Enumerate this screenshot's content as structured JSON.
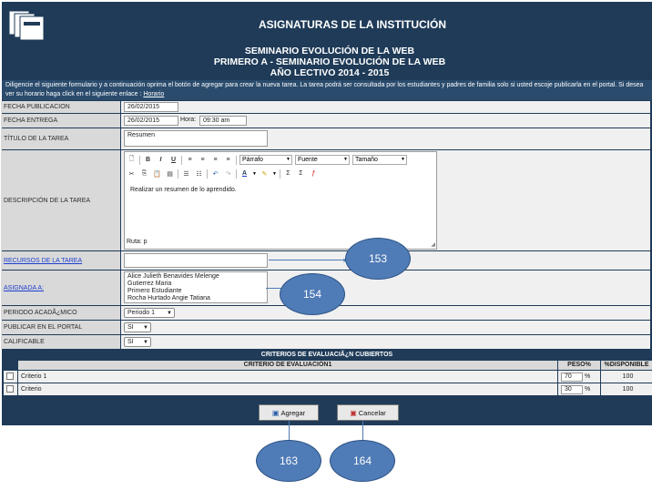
{
  "header": {
    "title": "ASIGNATURAS DE LA INSTITUCIÓN",
    "line1": "SEMINARIO EVOLUCIÓN DE LA WEB",
    "line2": "PRIMERO A - SEMINARIO EVOLUCIÓN DE LA WEB",
    "line3": "AÑO LECTIVO 2014 - 2015"
  },
  "notice": {
    "text": "Diligencie el siguiente formulario y a continuación oprima el botón de agregar para crear la nueva tarea. La tarea podrá ser consultada por los estudiantes y padres de familia solo si usted escoje publicarla en el portal. Si desea ver su horario haga click en el siguiente enlace :",
    "link": "Horario"
  },
  "form": {
    "fecha_publicacion_label": "FECHA PUBLICACION",
    "fecha_publicacion_value": "26/02/2015",
    "fecha_entrega_label": "FECHA ENTREGA",
    "fecha_entrega_value": "26/02/2015",
    "hora_label": "Hora:",
    "hora_value": "09:30 am",
    "titulo_label": "TÍTULO DE LA TAREA",
    "titulo_value": "Resumen",
    "descripcion_label": "DESCRIPCIÓN DE LA TAREA",
    "descripcion_value": "Realizar un resumen de lo aprendido.",
    "editor_path": "Ruta: p",
    "editor_format": "Párrafo",
    "editor_font": "Fuente",
    "editor_size": "Tamaño",
    "recursos_label": "RECURSOS DE LA TAREA",
    "asignada_label": "ASIGNADA A:",
    "students": [
      "Alice Julieth Benavides Melenge",
      "Gutierrez Maria",
      "Primero Estudiante",
      "Rocha Hurtado Angie Tatiana"
    ],
    "periodo_label": "PERIODO ACADÃ¿MICO",
    "periodo_value": "Periodo 1",
    "publicar_label": "PUBLICAR EN EL PORTAL",
    "publicar_value": "SI",
    "calificable_label": "CALIFICABLE",
    "calificable_value": "SI"
  },
  "criteria": {
    "title": "CRITERIOS DE EVALUACIÃ¿N CUBIERTOS",
    "col_criterio": "CRITERIO DE EVALUACIÓN1",
    "col_peso": "PESO%",
    "col_disponible": "%DISPONIBLE",
    "rows": [
      {
        "name": "Criterio 1",
        "peso": "70",
        "pct": "%",
        "disponible": "100"
      },
      {
        "name": "Criterio",
        "peso": "30",
        "pct": "%",
        "disponible": "100"
      }
    ]
  },
  "buttons": {
    "agregar": "Agregar",
    "cancelar": "Cancelar"
  },
  "callouts": {
    "c153": "153",
    "c154": "154",
    "c163": "163",
    "c164": "164"
  }
}
